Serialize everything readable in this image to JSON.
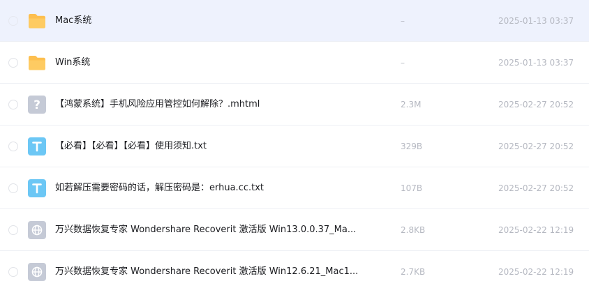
{
  "files": [
    {
      "name": "Mac系统",
      "size": "–",
      "modified": "2025-01-13 03:37",
      "icon": "folder-icon",
      "selected": true
    },
    {
      "name": "Win系统",
      "size": "–",
      "modified": "2025-01-13 03:37",
      "icon": "folder-icon",
      "selected": false
    },
    {
      "name": "【鸿蒙系统】手机风险应用管控如何解除？.mhtml",
      "size": "2.3M",
      "modified": "2025-02-27 20:52",
      "icon": "unknown-file-icon",
      "selected": false
    },
    {
      "name": "【必看】【必看】【必看】使用须知.txt",
      "size": "329B",
      "modified": "2025-02-27 20:52",
      "icon": "text-file-icon",
      "selected": false
    },
    {
      "name": "如若解压需要密码的话，解压密码是：erhua.cc.txt",
      "size": "107B",
      "modified": "2025-02-27 20:52",
      "icon": "text-file-icon",
      "selected": false
    },
    {
      "name": "万兴数据恢复专家 Wondershare Recoverit 激活版 Win13.0.0.37_Ma...",
      "size": "2.8KB",
      "modified": "2025-02-22 12:19",
      "icon": "web-file-icon",
      "selected": false
    },
    {
      "name": "万兴数据恢复专家 Wondershare Recoverit 激活版 Win12.6.21_Mac1...",
      "size": "2.7KB",
      "modified": "2025-02-22 12:19",
      "icon": "web-file-icon",
      "selected": false
    }
  ],
  "colors": {
    "selected_row": "#eef2fd",
    "folder": "#fdbf4f",
    "text_file": "#6cc7f5",
    "unknown_file": "#c5cad6",
    "web_file": "#c5cad6"
  }
}
